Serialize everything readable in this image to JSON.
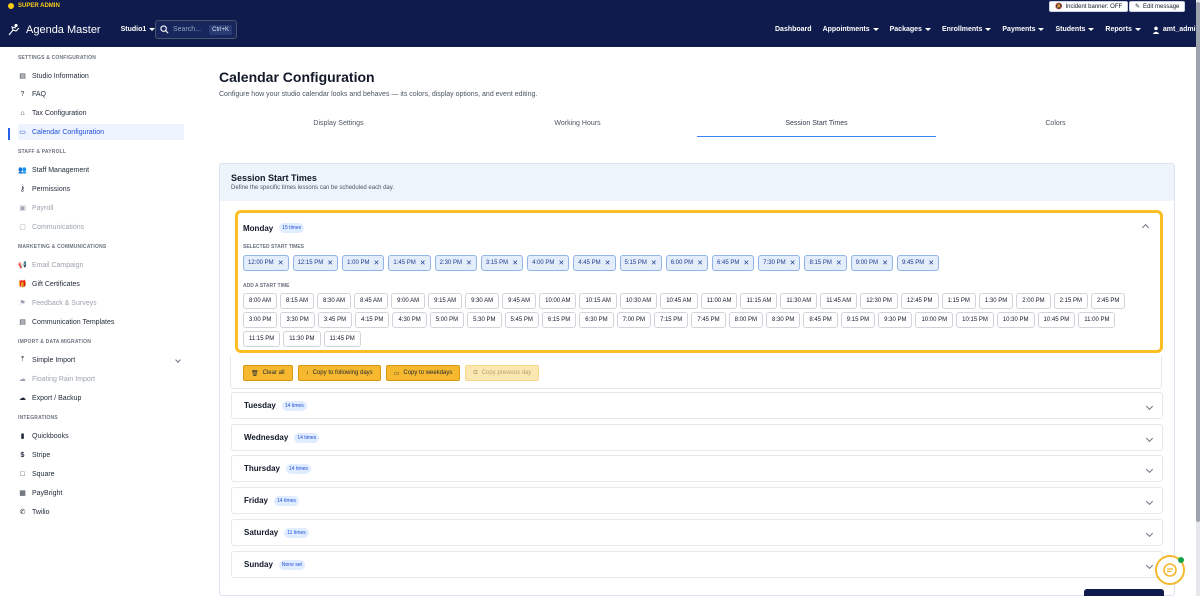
{
  "admin_strip": {
    "badge": "SUPER ADMIN",
    "incident_banner": "Incident banner: OFF",
    "edit_message": "Edit message"
  },
  "navbar": {
    "app_name": "Agenda Master",
    "studio": "Studio1",
    "search_placeholder": "Search...",
    "search_shortcut": "Ctrl+K",
    "links": [
      "Dashboard",
      "Appointments",
      "Packages",
      "Enrollments",
      "Payments",
      "Students",
      "Reports"
    ],
    "user": "amt_admin"
  },
  "sidebar": {
    "sections": {
      "settings": "SETTINGS & CONFIGURATION",
      "staff": "STAFF & PAYROLL",
      "marketing": "MARKETING & COMMUNICATIONS",
      "import": "IMPORT & DATA MIGRATION",
      "integrations": "INTEGRATIONS"
    },
    "items": {
      "studio_info": "Studio Information",
      "faq": "FAQ",
      "tax": "Tax Configuration",
      "calendar": "Calendar Configuration",
      "staff_mgmt": "Staff Management",
      "permissions": "Permissions",
      "payroll": "Payroll",
      "communications": "Communications",
      "email_campaign": "Email Campaign",
      "gift_certificates": "Gift Certificates",
      "feedback": "Feedback & Surveys",
      "comm_templates": "Communication Templates",
      "simple_import": "Simple Import",
      "floating_rain": "Floating Rain Import",
      "export_backup": "Export / Backup",
      "quickbooks": "Quickbooks",
      "stripe": "Stripe",
      "square": "Square",
      "paybright": "PayBright",
      "twilio": "Twilio"
    }
  },
  "main": {
    "title": "Calendar Configuration",
    "subtitle": "Configure how your studio calendar looks and behaves — its colors, display options, and event editing.",
    "tabs": [
      "Display Settings",
      "Working Hours",
      "Session Start Times",
      "Colors"
    ],
    "active_tab": "Session Start Times",
    "panel_title": "Session Start Times",
    "panel_subtitle": "Define the specific times lessons can be scheduled each day.",
    "monday": {
      "name": "Monday",
      "count": "15 times",
      "selected_label": "SELECTED START TIMES",
      "add_label": "ADD A START TIME",
      "selected": [
        "12:00 PM",
        "12:15 PM",
        "1:00 PM",
        "1:45 PM",
        "2:30 PM",
        "3:15 PM",
        "4:00 PM",
        "4:45 PM",
        "5:15 PM",
        "6:00 PM",
        "6:45 PM",
        "7:30 PM",
        "8:15 PM",
        "9:00 PM",
        "9:45 PM"
      ],
      "available": [
        "8:00 AM",
        "8:15 AM",
        "8:30 AM",
        "8:45 AM",
        "9:00 AM",
        "9:15 AM",
        "9:30 AM",
        "9:45 AM",
        "10:00 AM",
        "10:15 AM",
        "10:30 AM",
        "10:45 AM",
        "11:00 AM",
        "11:15 AM",
        "11:30 AM",
        "11:45 AM",
        "12:30 PM",
        "12:45 PM",
        "1:15 PM",
        "1:30 PM",
        "2:00 PM",
        "2:15 PM",
        "2:45 PM",
        "3:00 PM",
        "3:30 PM",
        "3:45 PM",
        "4:15 PM",
        "4:30 PM",
        "5:00 PM",
        "5:30 PM",
        "5:45 PM",
        "6:15 PM",
        "6:30 PM",
        "7:00 PM",
        "7:15 PM",
        "7:45 PM",
        "8:00 PM",
        "8:30 PM",
        "8:45 PM",
        "9:15 PM",
        "9:30 PM",
        "10:00 PM",
        "10:15 PM",
        "10:30 PM",
        "10:45 PM",
        "11:00 PM",
        "11:15 PM",
        "11:30 PM",
        "11:45 PM"
      ]
    },
    "actions": {
      "clear_all": "Clear all",
      "copy_following": "Copy to following days",
      "copy_weekdays": "Copy to weekdays",
      "copy_previous": "Copy previous day"
    },
    "days": [
      {
        "name": "Tuesday",
        "count": "14 times"
      },
      {
        "name": "Wednesday",
        "count": "14 times"
      },
      {
        "name": "Thursday",
        "count": "14 times"
      },
      {
        "name": "Friday",
        "count": "14 times"
      },
      {
        "name": "Saturday",
        "count": "11 times"
      },
      {
        "name": "Sunday",
        "count": "None set"
      }
    ]
  },
  "colors": {
    "nav_bg": "#0f1b4c",
    "accent": "#f5b82e",
    "chip_blue": "#e3edfc"
  }
}
